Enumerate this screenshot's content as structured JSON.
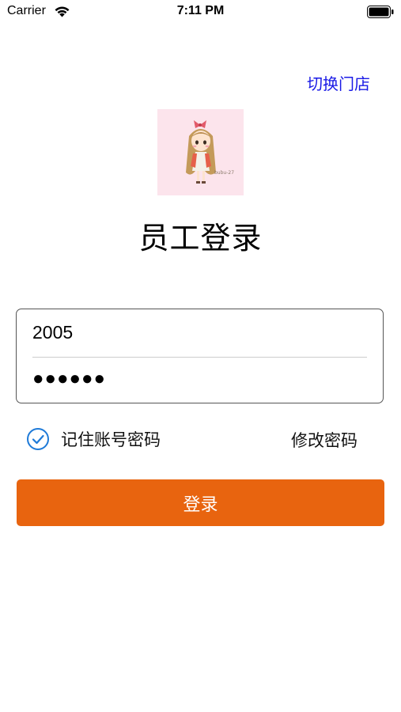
{
  "status_bar": {
    "carrier": "Carrier",
    "time": "7:11 PM",
    "icons": [
      "wifi-icon",
      "battery-icon"
    ]
  },
  "header": {
    "switch_store": "切换门店"
  },
  "avatar": {
    "icon": "cartoon-girl-avatar",
    "caption": "bubu-27"
  },
  "title": "员工登录",
  "form": {
    "account_value": "2005",
    "password_value": "●●●●●●"
  },
  "options": {
    "remember_label": "记住账号密码",
    "remember_checked": true,
    "change_password": "修改密码"
  },
  "login_button": "登录",
  "colors": {
    "link": "#1a1ae6",
    "primary": "#e8640f",
    "check": "#1e7ad8",
    "avatar_bg": "#fce4ec"
  }
}
